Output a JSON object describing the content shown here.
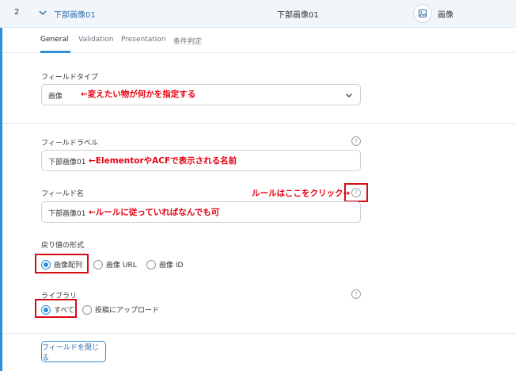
{
  "header": {
    "order": "2",
    "field_label": "下部画像01",
    "field_name": "下部画像01",
    "field_type": "画像"
  },
  "tabs": [
    {
      "label": "General",
      "active": true
    },
    {
      "label": "Validation",
      "active": false
    },
    {
      "label": "Presentation",
      "active": false
    },
    {
      "label": "条件判定",
      "active": false
    }
  ],
  "field_type_section": {
    "label": "フィールドタイプ",
    "value": "画像",
    "annotation": "←変えたい物が何かを指定する"
  },
  "field_label_section": {
    "label": "フィールドラベル",
    "value": "下部画像01",
    "annotation": "←ElementorやACFで表示される名前"
  },
  "field_name_section": {
    "label": "フィールド名",
    "value": "下部画像01",
    "annotation": "←ルールに従っていればなんでも可",
    "help_annotation": "ルールはここをクリック→"
  },
  "return_format": {
    "label": "戻り値の形式",
    "options": [
      "画像配列",
      "画像 URL",
      "画像 ID"
    ],
    "selected": "画像配列"
  },
  "library": {
    "label": "ライブラリ",
    "options": [
      "すべて",
      "投稿にアップロード"
    ],
    "selected": "すべて"
  },
  "close_button": "フィールドを閉じる",
  "colors": {
    "accent": "#2c8fd8",
    "annotation_red": "#e60012",
    "header_bg": "#f1f6fb"
  },
  "icons": {
    "collapse": "chevron-down-icon",
    "type": "image-icon",
    "select_arrow": "chevron-down-icon",
    "help": "question-circle-icon"
  }
}
